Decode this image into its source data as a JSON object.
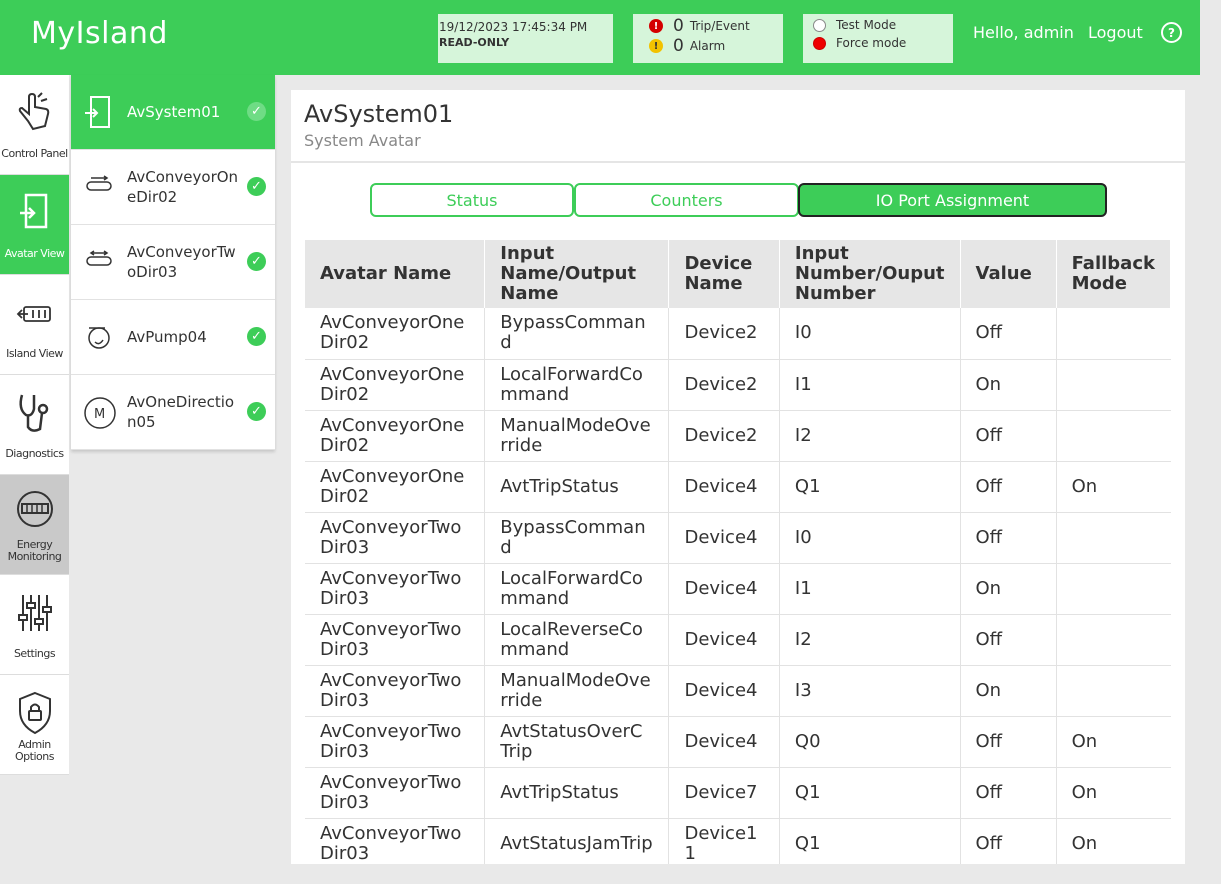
{
  "header": {
    "app_title": "MyIsland",
    "datetime": "19/12/2023 17:45:34 PM",
    "mode": "READ-ONLY",
    "trip_count": "0",
    "trip_label": "Trip/Event",
    "alarm_count": "0",
    "alarm_label": "Alarm",
    "test_mode": "Test Mode",
    "force_mode": "Force mode",
    "greeting": "Hello, admin",
    "logout": "Logout",
    "help": "?"
  },
  "nav": {
    "items": [
      {
        "label": "Control Panel",
        "icon": "hand-pointer-icon"
      },
      {
        "label": "Avatar View",
        "icon": "avatar-icon"
      },
      {
        "label": "Island View",
        "icon": "island-icon"
      },
      {
        "label": "Diagnostics",
        "icon": "stethoscope-icon"
      },
      {
        "label": "Energy Monitoring",
        "icon": "meter-icon"
      },
      {
        "label": "Settings",
        "icon": "sliders-icon"
      },
      {
        "label": "Admin Options",
        "icon": "shield-lock-icon"
      }
    ]
  },
  "avatars": [
    {
      "name": "AvSystem01",
      "icon": "system-avatar-icon"
    },
    {
      "name": "AvConveyorOneDir02",
      "icon": "conveyor-one-dir-icon"
    },
    {
      "name": "AvConveyorTwoDir03",
      "icon": "conveyor-two-dir-icon"
    },
    {
      "name": "AvPump04",
      "icon": "pump-icon"
    },
    {
      "name": "AvOneDirection05",
      "icon": "motor-icon"
    }
  ],
  "panel": {
    "title": "AvSystem01",
    "subtitle": "System Avatar",
    "tabs": [
      "Status",
      "Counters",
      "IO Port Assignment"
    ],
    "active_tab": "IO Port Assignment"
  },
  "table": {
    "headers": [
      "Avatar Name",
      "Input Name/Output Name",
      "Device Name",
      "Input Number/Ouput Number",
      "Value",
      "Fallback Mode"
    ],
    "rows": [
      [
        "AvConveyorOneDir02",
        "BypassCommand",
        "Device2",
        "I0",
        "Off",
        ""
      ],
      [
        "AvConveyorOneDir02",
        "LocalForwardCommand",
        "Device2",
        "I1",
        "On",
        ""
      ],
      [
        "AvConveyorOneDir02",
        "ManualModeOverride",
        "Device2",
        "I2",
        "Off",
        ""
      ],
      [
        "AvConveyorOneDir02",
        "AvtTripStatus",
        "Device4",
        "Q1",
        "Off",
        "On"
      ],
      [
        "AvConveyorTwoDir03",
        "BypassCommand",
        "Device4",
        "I0",
        "Off",
        ""
      ],
      [
        "AvConveyorTwoDir03",
        "LocalForwardCommand",
        "Device4",
        "I1",
        "On",
        ""
      ],
      [
        "AvConveyorTwoDir03",
        "LocalReverseCommand",
        "Device4",
        "I2",
        "Off",
        ""
      ],
      [
        "AvConveyorTwoDir03",
        "ManualModeOverride",
        "Device4",
        "I3",
        "On",
        ""
      ],
      [
        "AvConveyorTwoDir03",
        "AvtStatusOverCTrip",
        "Device4",
        "Q0",
        "Off",
        "On"
      ],
      [
        "AvConveyorTwoDir03",
        "AvtTripStatus",
        "Device7",
        "Q1",
        "Off",
        "On"
      ],
      [
        "AvConveyorTwoDir03",
        "AvtStatusJamTrip",
        "Device11",
        "Q1",
        "Off",
        "On"
      ]
    ]
  },
  "colors": {
    "brand_green": "#3dcd58",
    "light_green": "#d6f5da",
    "trip_red": "#d40000",
    "alarm_yellow": "#f2c200"
  }
}
